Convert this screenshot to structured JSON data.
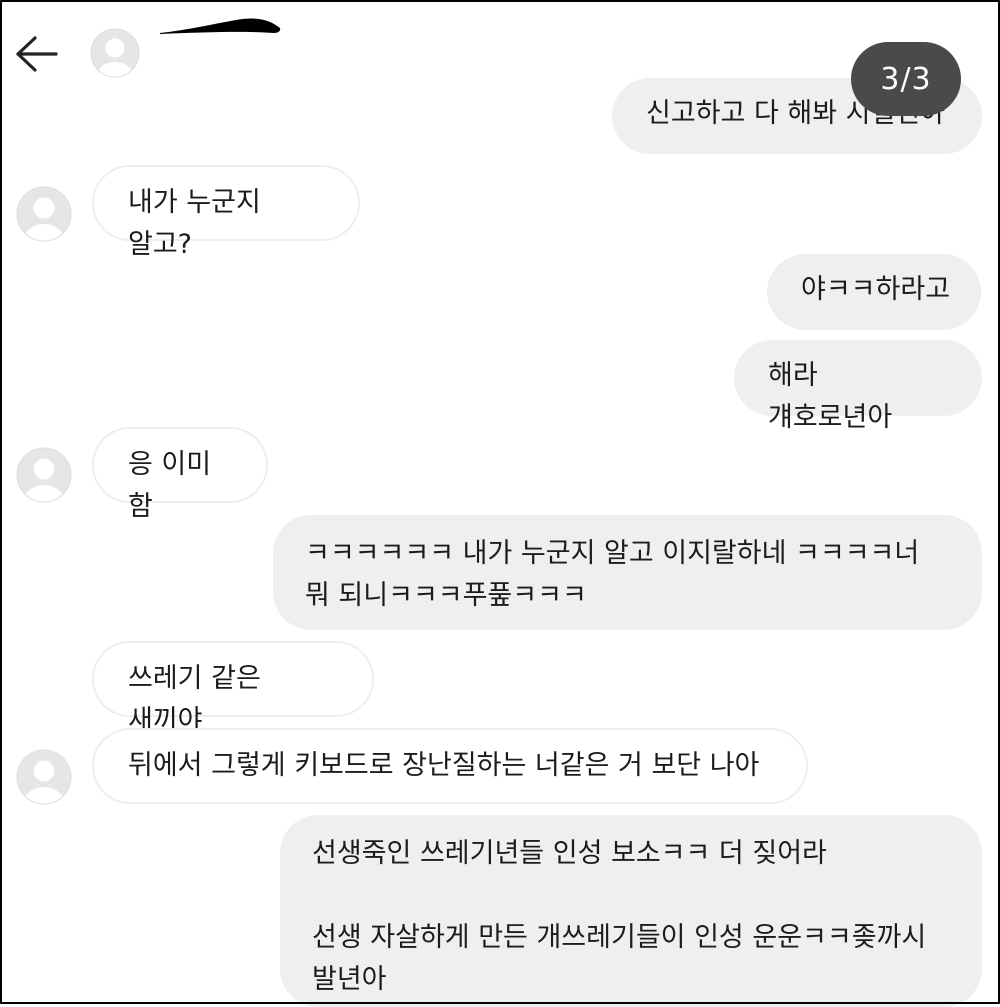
{
  "header": {
    "back_icon": "arrow-left-icon",
    "avatar_icon": "default-avatar-icon",
    "page_indicator": "3/3"
  },
  "colors": {
    "outgoing_bubble": "#efefef",
    "incoming_bubble": "#ffffff",
    "incoming_border": "#eeeeee",
    "page_indicator_bg": "#4a4a4a",
    "avatar_bg": "#e6e6e6",
    "avatar_fg": "#ffffff"
  },
  "messages": [
    {
      "direction": "out",
      "text": "신고하고 다 해봐 시벌년아"
    },
    {
      "direction": "in",
      "avatar": true,
      "text": "내가 누군지 알고?"
    },
    {
      "direction": "out",
      "text": "야ㅋㅋ하라고"
    },
    {
      "direction": "out",
      "text": "해라 걔호로년아"
    },
    {
      "direction": "in",
      "avatar": true,
      "text": "응 이미 함"
    },
    {
      "direction": "out",
      "text": "ㅋㅋㅋㅋㅋㅋ 내가 누군지 알고 이지랄하네 ㅋㅋㅋㅋ너\n뭐 되니ㅋㅋㅋ푸풒ㅋㅋㅋ"
    },
    {
      "direction": "in",
      "avatar": false,
      "text": "쓰레기 같은 새끼야"
    },
    {
      "direction": "in",
      "avatar": true,
      "text": "뒤에서 그렇게 키보드로 장난질하는 너같은 거 보단 나아"
    },
    {
      "direction": "out",
      "text": "선생죽인 쓰레기년들 인성 보소ㅋㅋ 더 짖어라\n\n선생 자살하게 만든 개쓰레기들이 인성 운운ㅋㅋ좆까시\n발년아"
    }
  ]
}
